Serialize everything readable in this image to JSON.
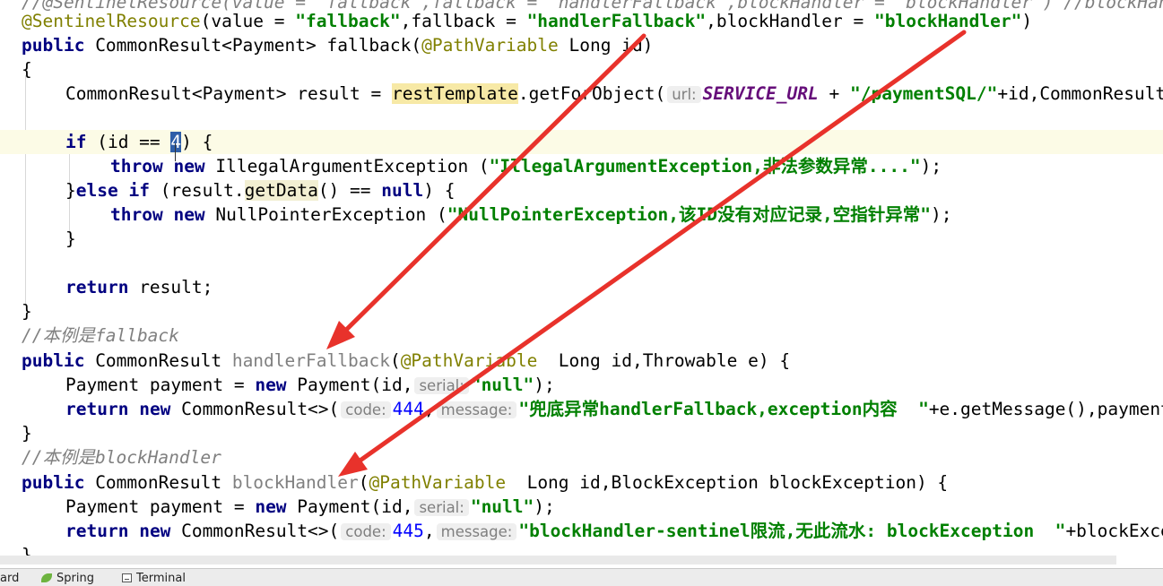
{
  "editor": {
    "line0": {
      "comment": "//@SentinelResource(value = \"fallback\",fallback = \"handlerFallback\",blockHandler = \"blockHandler\") //blockHandler只负责sentinel控制台"
    },
    "line1": {
      "annotation": "@SentinelResource",
      "p1": "(value = ",
      "s1": "\"fallback\"",
      "p2": ",fallback = ",
      "s2": "\"handlerFallback\"",
      "p3": ",blockHandler = ",
      "s3": "\"blockHandler\"",
      "p4": ")"
    },
    "line2": {
      "kw": "public",
      "p1": " CommonResult<Payment> fallback(",
      "ann": "@PathVariable",
      "p2": " Long id)"
    },
    "line3": {
      "text": "{"
    },
    "line4": {
      "p1": "CommonResult<Payment> result = ",
      "hl": "restTemplate",
      "p2": ".getForObject(",
      "hint": "url:",
      "const": "SERVICE_URL",
      "p3": " + ",
      "str": "\"/paymentSQL/\"",
      "p4": "+id,CommonResult.class,id);"
    },
    "line6": {
      "kw": "if",
      "p1": " (id == ",
      "sel": "4",
      "p2": ") {"
    },
    "line7": {
      "kw1": "throw",
      "kw2": "new",
      "p1": " IllegalArgumentException (",
      "str": "\"IllegalArgumentException,非法参数异常....\"",
      "p2": ");"
    },
    "line8": {
      "p0": "}",
      "kw1": "else",
      "kw2": "if",
      "p1": " (result.",
      "m": "getData",
      "p2": "() == ",
      "kw3": "null",
      "p3": ") {"
    },
    "line9": {
      "kw1": "throw",
      "kw2": "new",
      "p1": " NullPointerException (",
      "str": "\"NullPointerException,该ID没有对应记录,空指针异常\"",
      "p2": ");"
    },
    "line10": {
      "text": "}"
    },
    "line12": {
      "kw": "return",
      "p1": " result;"
    },
    "line13": {
      "text": "}"
    },
    "line14": {
      "comment": "//本例是fallback"
    },
    "line15": {
      "kw": "public",
      "p1": " CommonResult ",
      "m": "handlerFallback",
      "p2": "(",
      "ann": "@PathVariable",
      "p3": "  Long id,Throwable e) {"
    },
    "line16": {
      "p1": "Payment payment = ",
      "kw": "new",
      "p2": " Payment(id,",
      "hint": "serial:",
      "str": "\"null\"",
      "p3": ");"
    },
    "line17": {
      "kw1": "return",
      "kw2": "new",
      "p1": " CommonResult<>(",
      "hint1": "code:",
      "num": "444",
      "p2": ",",
      "hint2": "message:",
      "str": "\"兜底异常handlerFallback,exception内容  \"",
      "p3": "+e.getMessage(),payment);"
    },
    "line18": {
      "text": "}"
    },
    "line19": {
      "comment": "//本例是blockHandler"
    },
    "line20": {
      "kw": "public",
      "p1": " CommonResult ",
      "m": "blockHandler",
      "p2": "(",
      "ann": "@PathVariable",
      "p3": "  Long id,BlockException blockException) {"
    },
    "line21": {
      "p1": "Payment payment = ",
      "kw": "new",
      "p2": " Payment(id,",
      "hint": "serial:",
      "str": "\"null\"",
      "p3": ");"
    },
    "line22": {
      "kw1": "return",
      "kw2": "new",
      "p1": " CommonResult<>(",
      "hint1": "code:",
      "num": "445",
      "p2": ",",
      "hint2": "message:",
      "str": "\"blockHandler-sentinel限流,无此流水: blockException  \"",
      "p3": "+blockException.getMessage(),payment);"
    },
    "line23": {
      "text": "}"
    }
  },
  "statusbar": {
    "tool1": "ard",
    "tool2": "Spring",
    "tool3": "Terminal"
  },
  "colors": {
    "keyword": "#000080",
    "string": "#008000",
    "annotation": "#808000",
    "arrow": "#e8322b"
  }
}
